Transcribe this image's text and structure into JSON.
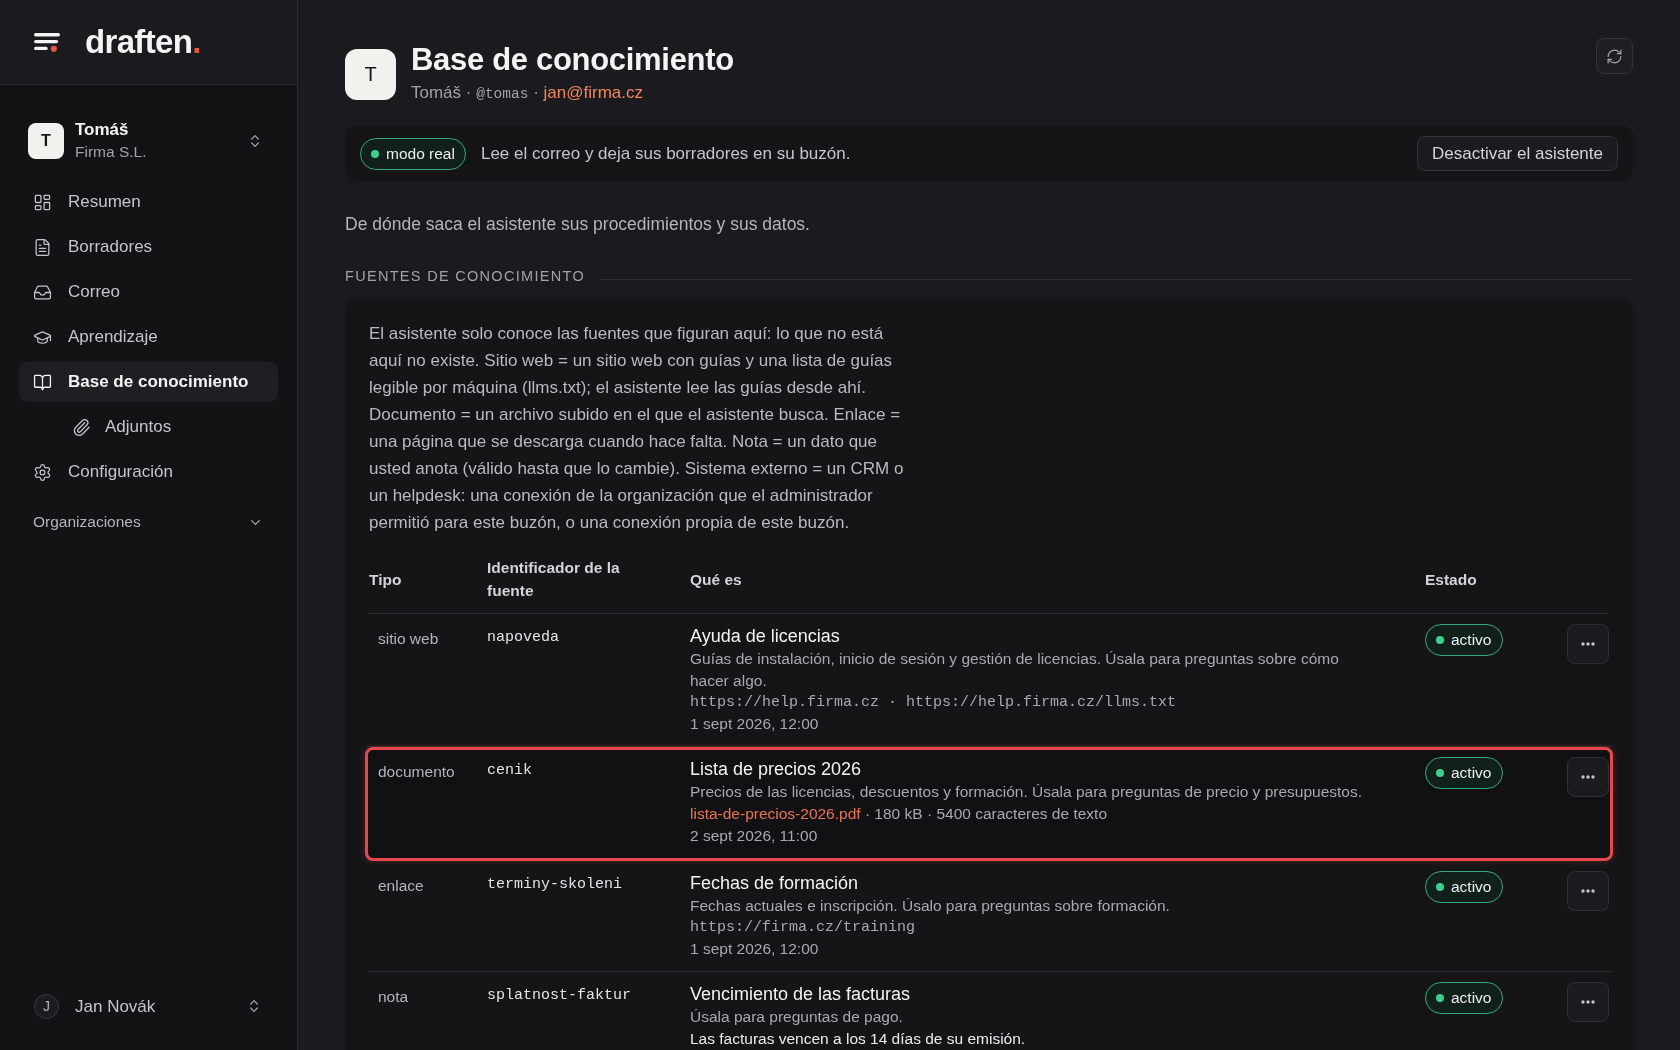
{
  "sidebar": {
    "brand": {
      "name": "draften",
      "dot": "."
    },
    "account": {
      "avatar": "T",
      "name": "Tomáš",
      "organization": "Firma S.L."
    },
    "nav": [
      {
        "label": "Resumen",
        "selected": false
      },
      {
        "label": "Borradores",
        "selected": false
      },
      {
        "label": "Correo",
        "selected": false
      },
      {
        "label": "Aprendizaje",
        "selected": false
      },
      {
        "label": "Base de conocimiento",
        "selected": true,
        "children": [
          {
            "label": "Adjuntos",
            "selected": false
          }
        ]
      },
      {
        "label": "Configuración",
        "selected": false
      }
    ],
    "organizations": {
      "label": "Organizaciones",
      "expanded": false
    },
    "user": {
      "avatar": "J",
      "name": "Jan Novák"
    }
  },
  "header": {
    "avatar": "T",
    "title": "Base de conocimiento",
    "meta": [
      {
        "kind": "text",
        "text": "Tomáš"
      },
      {
        "kind": "separator",
        "text": "·"
      },
      {
        "kind": "handle",
        "text": "@tomas"
      },
      {
        "kind": "separator",
        "text": "·"
      },
      {
        "kind": "email",
        "text": "jan@firma.cz"
      }
    ]
  },
  "assistant": {
    "mode": "modo real",
    "text": "Lee el correo y deja sus borradores en su buzón.",
    "button": "Desactivar el asistente"
  },
  "description": "De dónde saca el asistente sus procedimientos y sus datos.",
  "sources": {
    "heading": "FUENTES DE CONOCIMIENTO",
    "intro": "El asistente solo conoce las fuentes que figuran aquí: lo que no está aquí no existe. Sitio web = un sitio web con guías y una lista de guías legible por máquina (llms.txt); el asistente lee las guías desde ahí. Documento = un archivo subido en el que el asistente busca. Enlace = una página que se descarga cuando hace falta. Nota = un dato que usted anota (válido hasta que lo cambie). Sistema externo = un CRM o un helpdesk: una conexión de la organización que el administrador permitió para este buzón, o una conexión propia de este buzón.",
    "columns": [
      "Tipo",
      "Identificador de la fuente",
      "Qué es",
      "Estado"
    ],
    "rows": [
      {
        "kind": "website",
        "type": "sitio web",
        "identifier": "napoveda",
        "title": "Ayuda de licencias",
        "description": "Guías de instalación, inicio de sesión y gestión de licencias. Úsala para preguntas sobre cómo hacer algo.",
        "urls": "https://help.firma.cz · https://help.firma.cz/llms.txt",
        "date": "1 sept 2026, 12:00",
        "status": "activo",
        "highlighted": false
      },
      {
        "kind": "document",
        "type": "documento",
        "identifier": "cenik",
        "title": "Lista de precios 2026",
        "description": "Precios de las licencias, descuentos y formación. Úsala para preguntas de precio y presupuestos.",
        "file": "lista-de-precios-2026.pdf",
        "file_info": "· 180 kB · 5400 caracteres de texto",
        "date": "2 sept 2026, 11:00",
        "status": "activo",
        "highlighted": true
      },
      {
        "kind": "link",
        "type": "enlace",
        "identifier": "terminy-skoleni",
        "title": "Fechas de formación",
        "description": "Fechas actuales e inscripción. Úsalo para preguntas sobre formación.",
        "url": "https://firma.cz/training",
        "date": "1 sept 2026, 12:00",
        "status": "activo",
        "highlighted": false
      },
      {
        "kind": "note",
        "type": "nota",
        "identifier": "splatnost-faktur",
        "title": "Vencimiento de las facturas",
        "description": "Úsala para preguntas de pago.",
        "note": "Las facturas vencen a los 14 días de su emisión.",
        "status": "activo",
        "highlighted": false
      }
    ]
  }
}
